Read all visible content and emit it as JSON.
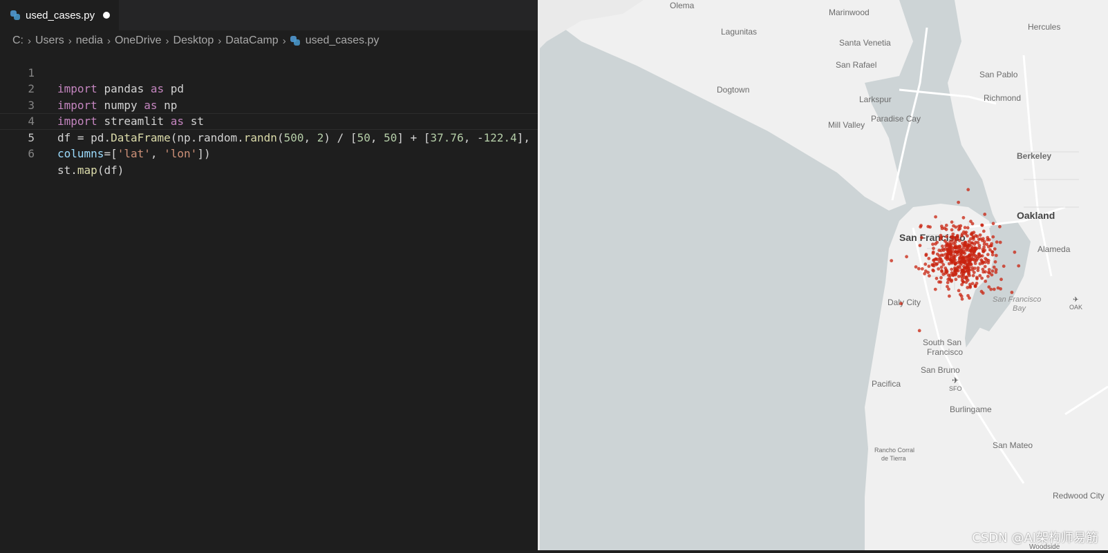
{
  "editor": {
    "tab": {
      "filename": "used_cases.py",
      "icon": "python-icon",
      "modified": true
    },
    "breadcrumb": [
      "C:",
      "Users",
      "nedia",
      "OneDrive",
      "Desktop",
      "DataCamp",
      "used_cases.py"
    ],
    "active_line": 5,
    "lines": [
      {
        "num": "1",
        "text": "import pandas as pd"
      },
      {
        "num": "2",
        "text": "import numpy as np"
      },
      {
        "num": "3",
        "text": "import streamlit as st"
      },
      {
        "num": "4",
        "text": "df = pd.DataFrame(np.random.randn(500, 2) / [50, 50] + [37.76, -122.4],"
      },
      {
        "num": "5",
        "text": "columns=['lat', 'lon'])"
      },
      {
        "num": "6",
        "text": "st.map(df)"
      }
    ]
  },
  "map": {
    "water_color": "#cdd4d6",
    "land_color": "#f2f2f2",
    "point_color": "#c8230f",
    "labels": {
      "olema": "Olema",
      "marinwood": "Marinwood",
      "lagunitas": "Lagunitas",
      "santa_venetia": "Santa Venetia",
      "hercules": "Hercules",
      "san_rafael": "San Rafael",
      "san_pablo": "San Pablo",
      "dogtown": "Dogtown",
      "larkspur": "Larkspur",
      "richmond": "Richmond",
      "paradise_cay": "Paradise Cay",
      "mill_valley": "Mill Valley",
      "berkeley": "Berkeley",
      "oakland": "Oakland",
      "san_francisco": "San Francisco",
      "alameda": "Alameda",
      "sf_bay_1": "San Francisco",
      "sf_bay_2": "Bay",
      "oak": "OAK",
      "daly_city": "Daly City",
      "south_sf_1": "South San",
      "south_sf_2": "Francisco",
      "san_bruno": "San Bruno",
      "pacifica": "Pacifica",
      "sfo": "SFO",
      "burlingame": "Burlingame",
      "rancho_1": "Rancho Corral",
      "rancho_2": "de Tierra",
      "san_mateo": "San Mateo",
      "redwood_city": "Redwood City",
      "woodside": "Woodside"
    },
    "scatter": {
      "n_points": 500,
      "center": {
        "lat": 37.76,
        "lon": -122.4
      },
      "spread": 0.02
    }
  },
  "watermark": "CSDN @AI架构师易筋"
}
